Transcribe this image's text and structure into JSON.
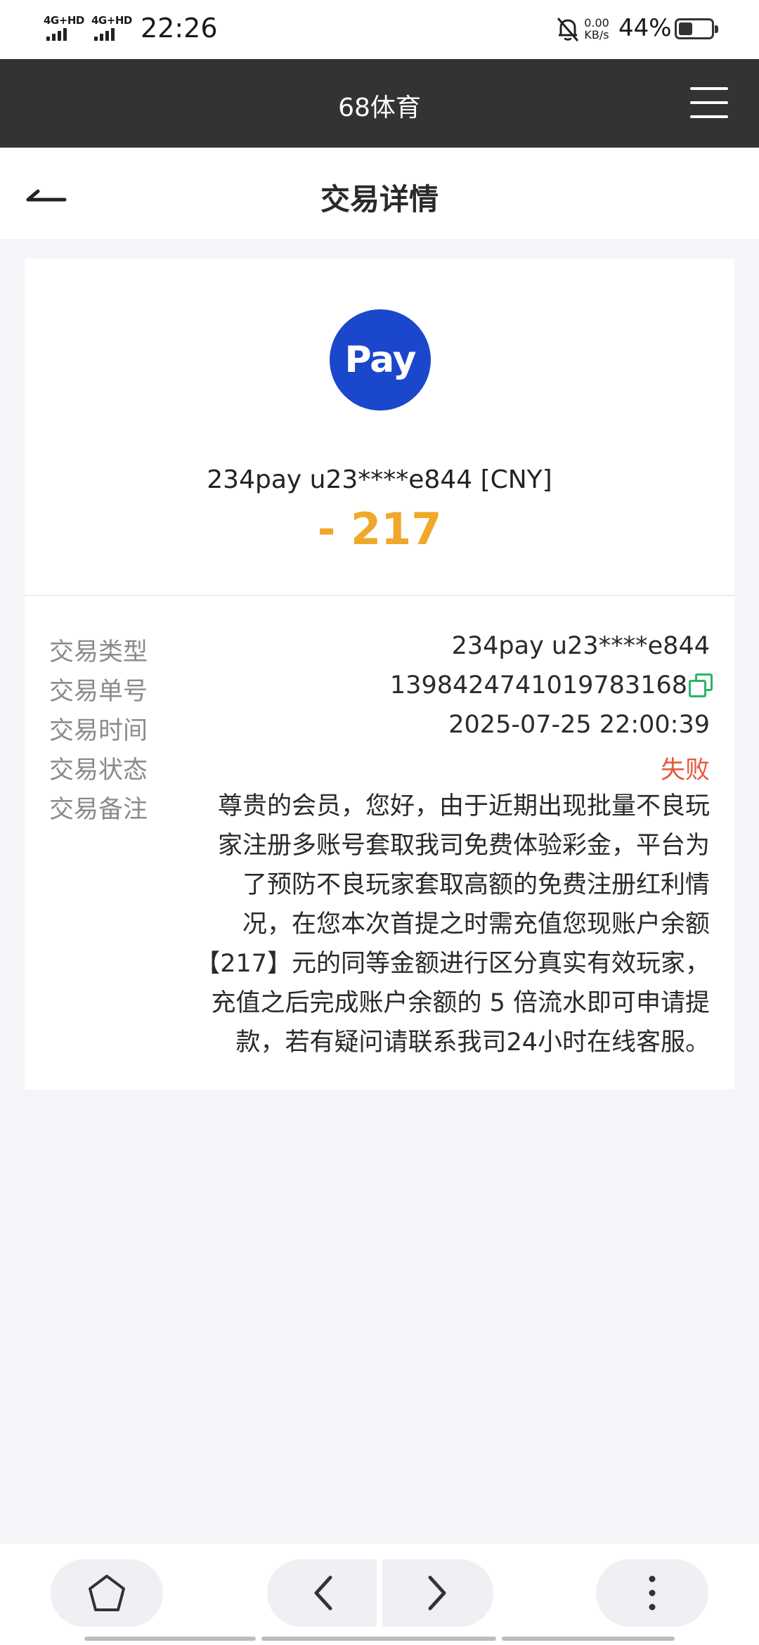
{
  "status_bar": {
    "sim1_label": "4G+HD",
    "sim2_label": "4G+HD",
    "time": "22:26",
    "net_speed_value": "0.00",
    "net_speed_unit": "KB/s",
    "battery_percent": "44%",
    "battery_level": 0.44,
    "icons": [
      "signal-icon",
      "bell-off-icon",
      "battery-icon"
    ]
  },
  "app_bar": {
    "title": "68体育",
    "menu_icon": "hamburger-icon"
  },
  "page_header": {
    "title": "交易详情",
    "back_icon": "back-arrow-icon"
  },
  "summary": {
    "logo_text": "Pay",
    "merchant": "234pay u23****e844 [CNY]",
    "amount": "- 217",
    "amount_color": "#f0a82a"
  },
  "details": [
    {
      "label": "交易类型",
      "value": "234pay u23****e844"
    },
    {
      "label": "交易单号",
      "value": "1398424741019783168"
    },
    {
      "label": "交易时间",
      "value": "2025-07-25 22:00:39"
    },
    {
      "label": "交易状态",
      "value": "失败"
    }
  ],
  "remark": {
    "label": "交易备注",
    "lines": [
      "尊贵的会员，您好，由于近期出现批量不良玩",
      "家注册多账号套取我司免费体验彩金，平台为",
      "了预防不良玩家套取高额的免费注册红利情",
      "况，在您本次首提之时需充值您现账户余额",
      "【217】元的同等金额进行区分真实有效玩家，",
      "充值之后完成账户余额的 5 倍流水即可申请提",
      "款，若有疑问请联系我司24小时在线客服。"
    ]
  },
  "colors": {
    "status_fail": "#e65a3b",
    "copy_icon": "#2bb36b",
    "pay_logo_bg": "#1a47cc",
    "app_bar_bg": "#333333"
  },
  "browser_nav": {
    "icons": [
      "home-icon",
      "back-chevron-icon",
      "forward-chevron-icon",
      "more-dots-icon"
    ]
  }
}
